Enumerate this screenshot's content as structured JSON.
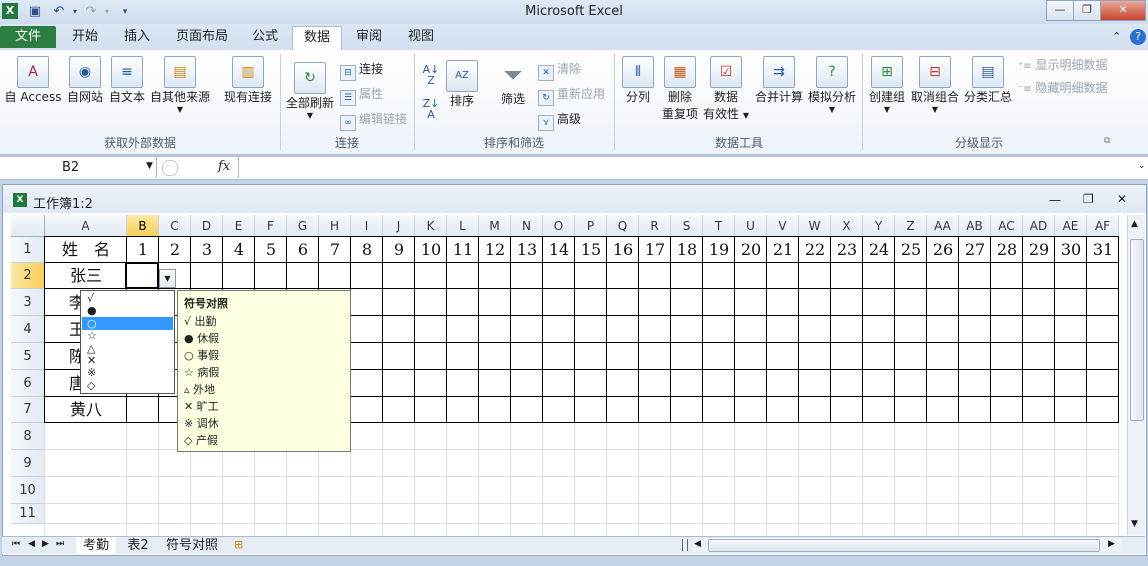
{
  "window": {
    "app_title": "Microsoft Excel",
    "minimize": "—",
    "restore": "❐",
    "close": "✕"
  },
  "ribbon_tabs": [
    "文件",
    "开始",
    "插入",
    "页面布局",
    "公式",
    "数据",
    "审阅",
    "视图"
  ],
  "active_tab_index": 5,
  "ribbon": {
    "groups": [
      "获取外部数据",
      "连接",
      "排序和筛选",
      "数据工具",
      "分级显示"
    ],
    "external": [
      "自 Access",
      "自网站",
      "自文本",
      "自其他来源",
      "现有连接"
    ],
    "connections": {
      "refresh_all": "全部刷新",
      "connect": "连接",
      "properties": "属性",
      "edit_links": "编辑链接"
    },
    "sort_filter": {
      "sort": "排序",
      "filter": "筛选",
      "clear": "清除",
      "reapply": "重新应用",
      "advanced": "高级"
    },
    "data_tools": {
      "split": "分列",
      "remove_dup_1": "删除",
      "remove_dup_2": "重复项",
      "validation_1": "数据",
      "validation_2": "有效性",
      "consolidate": "合并计算",
      "what_if": "模拟分析"
    },
    "outline": {
      "group": "创建组",
      "ungroup": "取消组合",
      "subtotal": "分类汇总",
      "show_detail": "显示明细数据",
      "hide_detail": "隐藏明细数据"
    }
  },
  "formula_bar": {
    "name_box": "B2",
    "fx": "fx",
    "content": ""
  },
  "workbook": {
    "title": "工作簿1:2"
  },
  "columns": [
    "A",
    "B",
    "C",
    "D",
    "E",
    "F",
    "G",
    "H",
    "I",
    "J",
    "K",
    "L",
    "M",
    "N",
    "O",
    "P",
    "Q",
    "R",
    "S",
    "T",
    "U",
    "V",
    "W",
    "X",
    "Y",
    "Z",
    "AA",
    "AB",
    "AC",
    "AD",
    "AE",
    "AF"
  ],
  "rows": [
    "1",
    "2",
    "3",
    "4",
    "5",
    "6",
    "7",
    "8",
    "9",
    "10",
    "11"
  ],
  "header_row": {
    "a1": "姓　名",
    "days": [
      "1",
      "2",
      "3",
      "4",
      "5",
      "6",
      "7",
      "8",
      "9",
      "10",
      "11",
      "12",
      "13",
      "14",
      "15",
      "16",
      "17",
      "18",
      "19",
      "20",
      "21",
      "22",
      "23",
      "24",
      "25",
      "26",
      "27",
      "28",
      "29",
      "30",
      "31"
    ]
  },
  "names": [
    "张三",
    "李",
    "王",
    "陈",
    "唐",
    "黄八"
  ],
  "dropdown": {
    "items": [
      "√",
      "●",
      "○",
      "☆",
      "△",
      "✕",
      "※",
      "◇"
    ],
    "selected_index": 2
  },
  "tooltip": {
    "title": "符号对照",
    "lines": [
      "√ 出勤",
      "● 休假",
      "○ 事假",
      "☆ 病假",
      "▵ 外地",
      "✕ 旷工",
      "※ 调休",
      "◇ 产假"
    ]
  },
  "sheets": [
    "考勤",
    "表2",
    "符号对照"
  ],
  "active_sheet": 0
}
